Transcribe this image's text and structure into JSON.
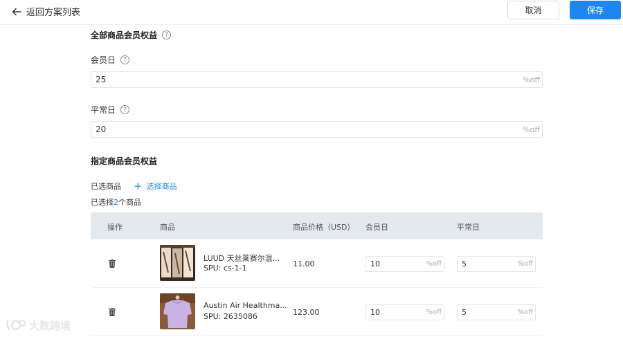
{
  "header": {
    "back_label": "返回方案列表",
    "cancel_label": "取消",
    "save_label": "保存"
  },
  "all_products": {
    "title": "全部商品会员权益",
    "member_day": {
      "label": "会员日",
      "value": "25",
      "suffix": "%off"
    },
    "normal_day": {
      "label": "平常日",
      "value": "20",
      "suffix": "%off"
    }
  },
  "specified_products": {
    "title": "指定商品会员权益",
    "picked_label": "已选商品",
    "add_label": "选择商品",
    "selected_prefix": "已选择",
    "selected_count": "2",
    "selected_suffix": "个商品"
  },
  "table": {
    "headers": [
      "操作",
      "商品",
      "商品价格（USD）",
      "会员日",
      "平常日"
    ],
    "rows": [
      {
        "name": "LUUD 天丝莱赛尔混...",
        "spu": "SPU: cs-1-1",
        "price": "11.00",
        "member_value": "10",
        "normal_value": "5",
        "suffix": "%off"
      },
      {
        "name": "Austin Air Healthma...",
        "spu": "SPU: 2635086",
        "price": "123.00",
        "member_value": "10",
        "normal_value": "5",
        "suffix": "%off"
      }
    ]
  },
  "watermark": "大数跨境",
  "colors": {
    "accent": "#1f86f0",
    "table_header": "#e4e9f0"
  }
}
